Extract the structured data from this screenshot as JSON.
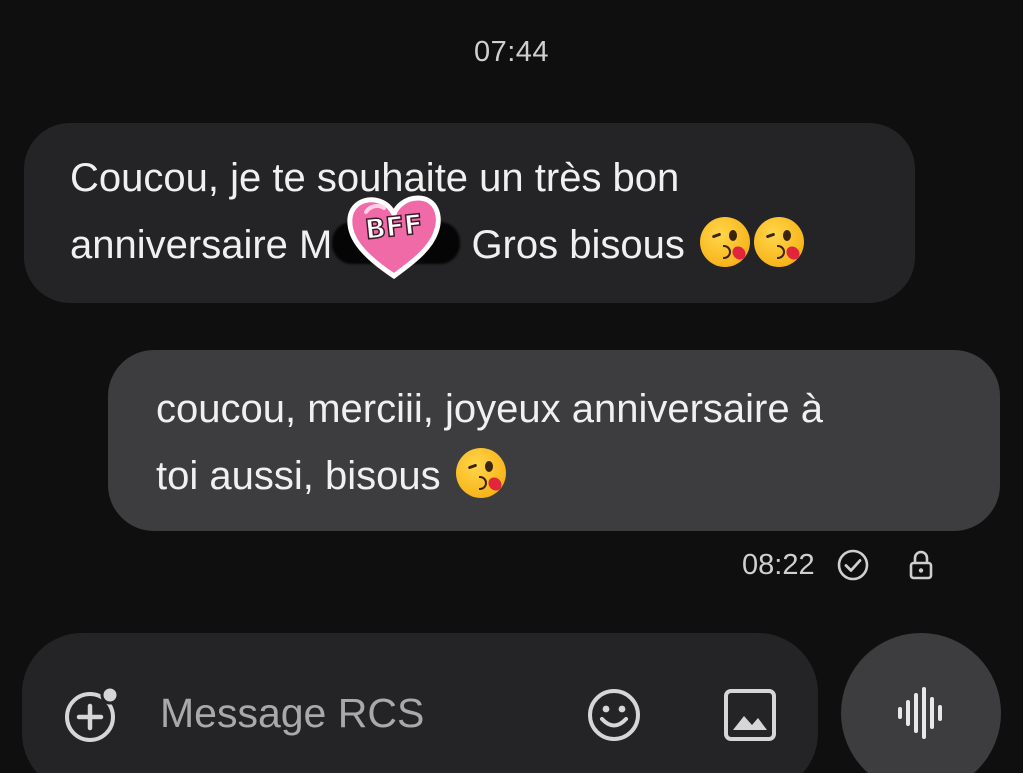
{
  "conversation": {
    "top_time": "07:44",
    "incoming": {
      "line1": "Coucou, je te souhaite un très bon",
      "line2_before": "anniversaire M",
      "line2_after": " Gros bisous",
      "sticker_text": "BFF",
      "emoji_count": 2
    },
    "outgoing": {
      "line1": "coucou, merciii, joyeux anniversaire à",
      "line2": "toi aussi, bisous",
      "emoji_count": 1,
      "time": "08:22",
      "status_icon": "check-circle-icon",
      "encryption_icon": "lock-icon"
    }
  },
  "composer": {
    "placeholder": "Message RCS",
    "attach_icon": "add-circle-icon",
    "emoji_icon": "emoji-smile-icon",
    "gallery_icon": "image-icon",
    "voice_icon": "voice-waveform-icon"
  },
  "colors": {
    "background": "#0f0f10",
    "incoming_bubble": "#242426",
    "outgoing_bubble": "#3d3d3f",
    "sticker_pink": "#f06aa8"
  }
}
